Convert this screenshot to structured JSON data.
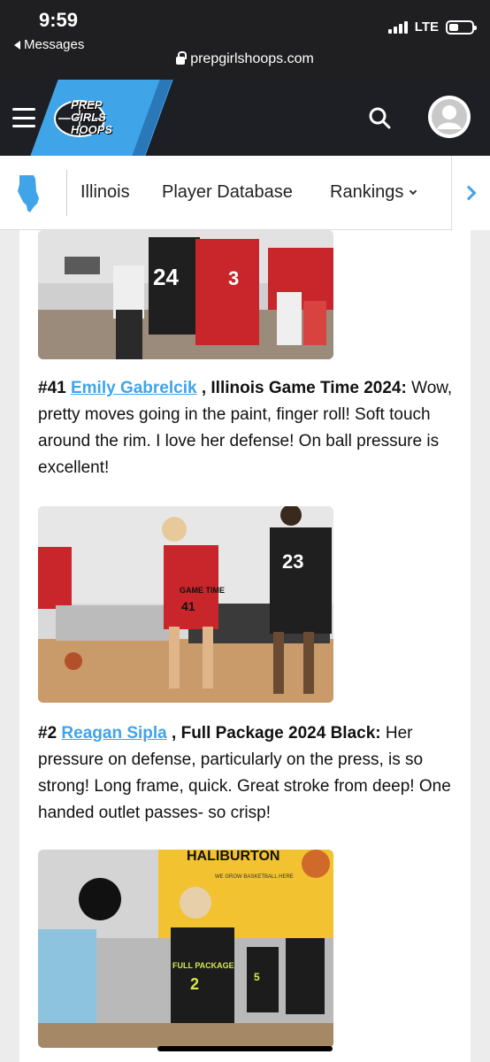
{
  "status_bar": {
    "time": "9:59",
    "back_label": "Messages",
    "network": "LTE",
    "url": "prepgirlshoops.com"
  },
  "header": {
    "logo_lines": [
      "PREP",
      "GIRLS",
      "HOOPS"
    ],
    "brand_color": "#3fa4e8"
  },
  "nav": {
    "items": [
      "Illinois",
      "Player Database",
      "Rankings"
    ]
  },
  "article": {
    "entries": [
      {
        "number": "#41",
        "player": "Emily Gabrelcik",
        "team": ", Illinois Game Time 2024:",
        "text": " Wow, pretty moves going in the paint, finger roll! Soft touch around the rim. I love her defense! On ball pressure is excellent!"
      },
      {
        "number": "#2",
        "player": "Reagan Sipla",
        "team": ", Full Package 2024 Black:",
        "text": "  Her pressure on defense, particularly on the press, is so strong! Long frame, quick.  Great stroke from deep!  One handed outlet passes- so crisp!"
      }
    ],
    "photo_jerseys": {
      "photo1": [
        "24",
        "3"
      ],
      "photo2": [
        "41",
        "23"
      ],
      "photo3": [
        "2",
        "5"
      ]
    },
    "photo_texts": {
      "jersey_team": "GAME TIME",
      "banner": "HALIBURTON",
      "banner_sub": "WE GROW BASKETBALL HERE",
      "jersey_text": "FULL PACKAGE"
    }
  }
}
